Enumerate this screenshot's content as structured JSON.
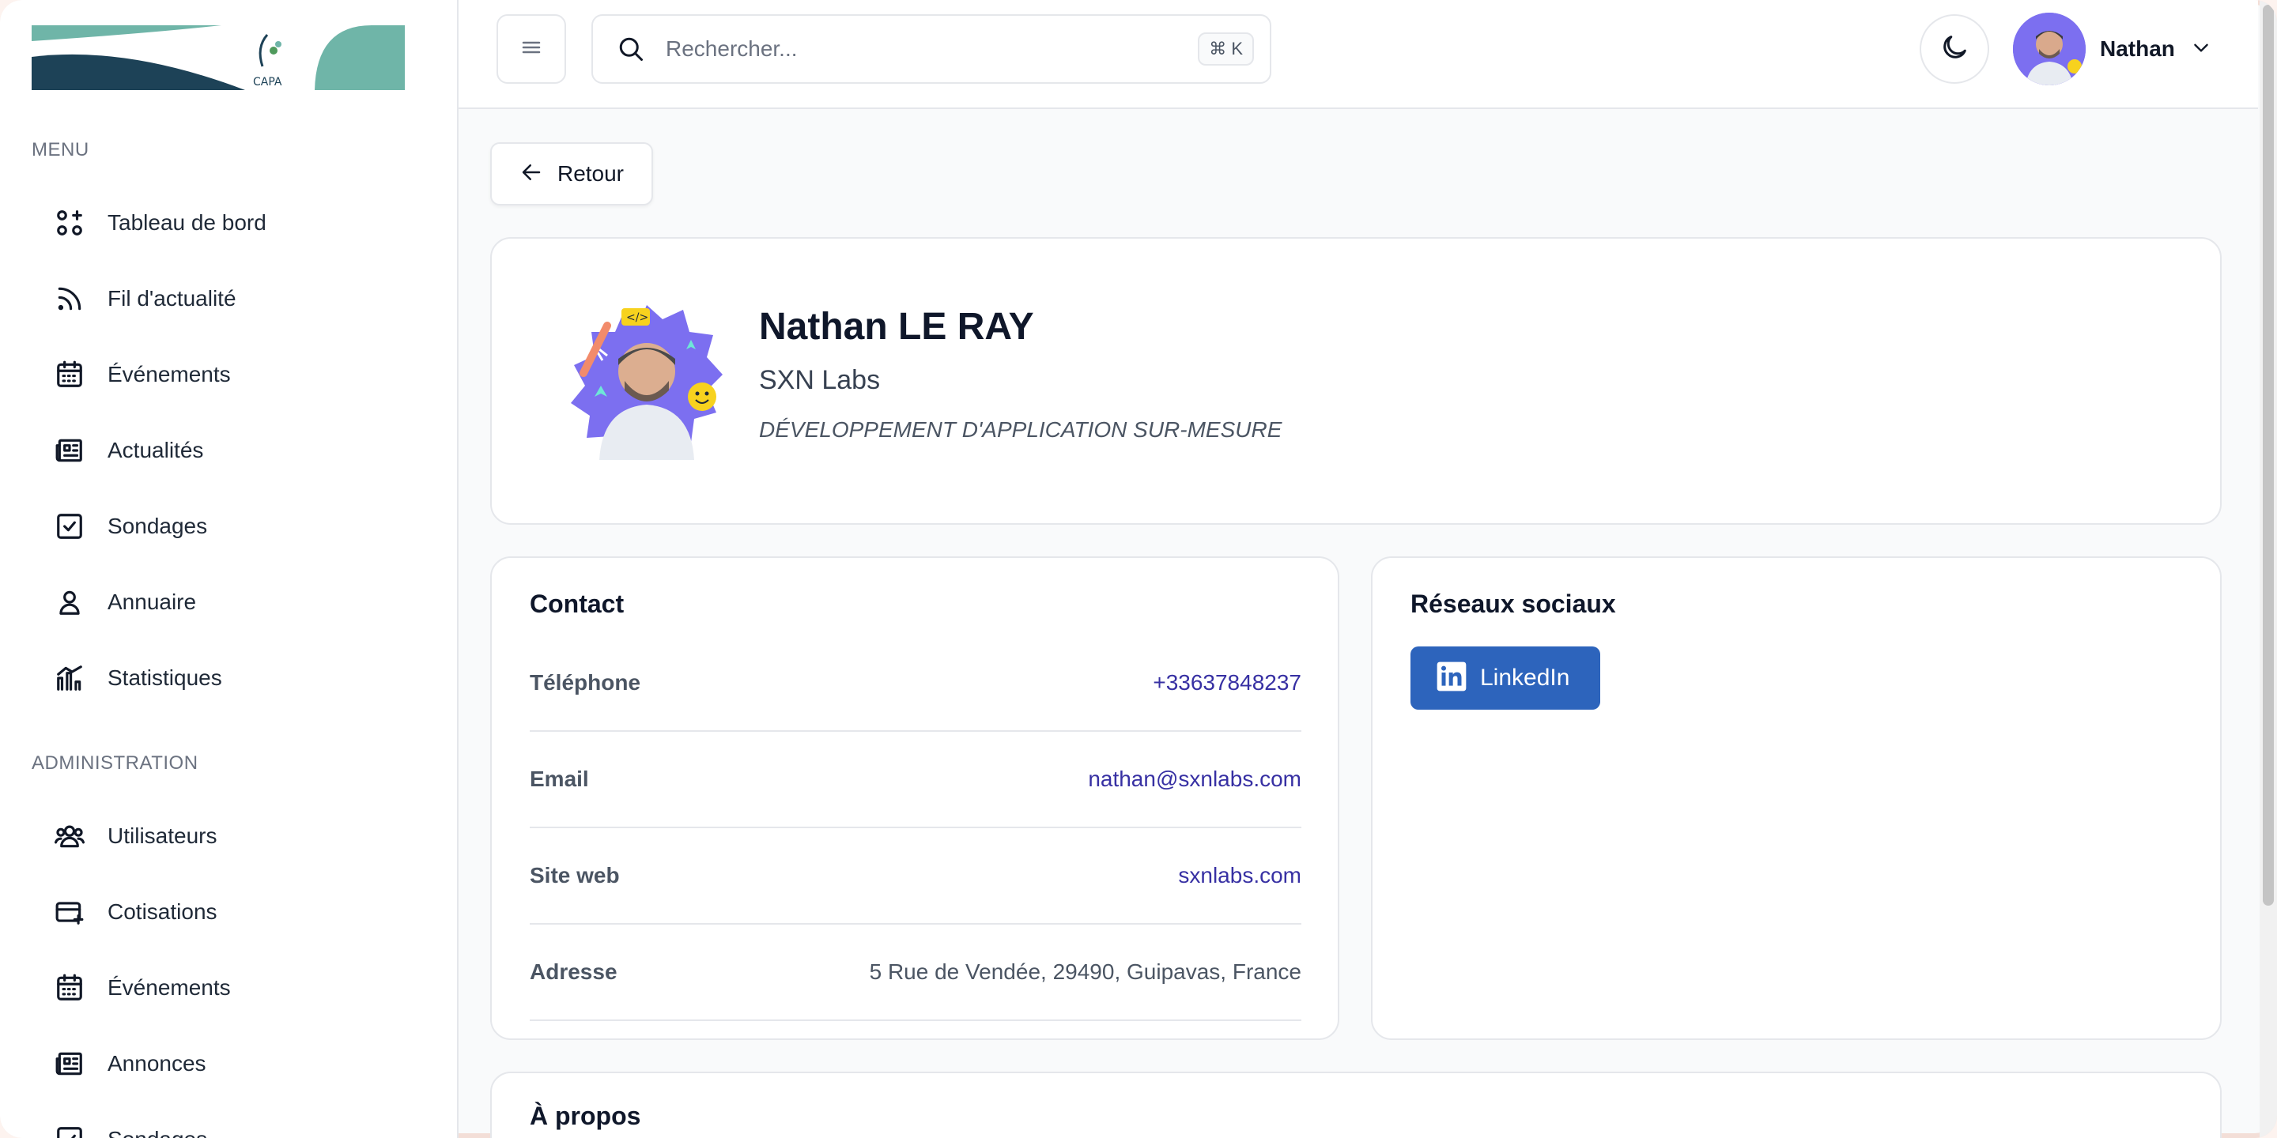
{
  "sidebar": {
    "menu_label": "MENU",
    "admin_label": "ADMINISTRATION",
    "menu_items": [
      {
        "label": "Tableau de bord",
        "icon": "dashboard-icon"
      },
      {
        "label": "Fil d'actualité",
        "icon": "rss-icon"
      },
      {
        "label": "Événements",
        "icon": "calendar-icon"
      },
      {
        "label": "Actualités",
        "icon": "newspaper-icon"
      },
      {
        "label": "Sondages",
        "icon": "checkbox-icon"
      },
      {
        "label": "Annuaire",
        "icon": "user-icon"
      },
      {
        "label": "Statistiques",
        "icon": "bar-chart-icon"
      }
    ],
    "admin_items": [
      {
        "label": "Utilisateurs",
        "icon": "users-icon"
      },
      {
        "label": "Cotisations",
        "icon": "credit-card-icon"
      },
      {
        "label": "Événements",
        "icon": "calendar-icon"
      },
      {
        "label": "Annonces",
        "icon": "newspaper-icon"
      },
      {
        "label": "Sondages",
        "icon": "checkbox-icon"
      }
    ]
  },
  "header": {
    "search_placeholder": "Rechercher...",
    "search_shortcut": "⌘ K",
    "user_name": "Nathan"
  },
  "main": {
    "back_label": "Retour",
    "profile": {
      "name": "Nathan LE RAY",
      "company": "SXN Labs",
      "activity": "DÉVELOPPEMENT D'APPLICATION SUR-MESURE"
    },
    "contact": {
      "title": "Contact",
      "rows": [
        {
          "key": "Téléphone",
          "value": "+33637848237"
        },
        {
          "key": "Email",
          "value": "nathan@sxnlabs.com"
        },
        {
          "key": "Site web",
          "value": "sxnlabs.com"
        },
        {
          "key": "Adresse",
          "value": "5 Rue de Vendée, 29490, Guipavas, France"
        }
      ]
    },
    "social": {
      "title": "Réseaux sociaux",
      "linkedin_label": "LinkedIn"
    },
    "about": {
      "title": "À propos"
    }
  },
  "colors": {
    "accent": "#3730a3",
    "linkedin": "#2d64bc",
    "logo_dark": "#1d4257",
    "logo_teal": "#6fb5a8"
  }
}
